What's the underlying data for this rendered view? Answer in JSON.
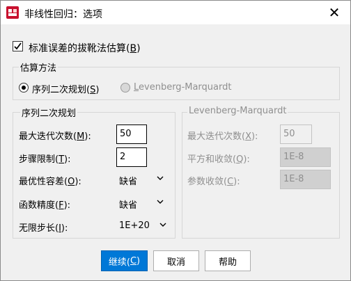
{
  "window": {
    "title": "非线性回归：选项",
    "close_glyph": "✕"
  },
  "bootstrap": {
    "checked": true,
    "label": "标准误差的拔靴法估算(",
    "mnemonic": "B",
    "suffix": ")"
  },
  "estimation": {
    "title": "估算方法",
    "options": [
      {
        "prefix": "序列二次规划(",
        "mnemonic": "S",
        "suffix": ")",
        "selected": true,
        "enabled": true
      },
      {
        "prefix": "",
        "mnemonic": "L",
        "suffix": "evenberg-Marquardt",
        "selected": false,
        "enabled": false
      }
    ]
  },
  "sqp": {
    "title": "序列二次规划",
    "fields": [
      {
        "prefix": "最大迭代次数(",
        "mnemonic": "M",
        "suffix": "):",
        "value": "50"
      },
      {
        "prefix": "步骤限制(",
        "mnemonic": "T",
        "suffix": "):",
        "value": "2"
      },
      {
        "prefix": "最优性容差(",
        "mnemonic": "O",
        "suffix": "):",
        "value": "缺省"
      },
      {
        "prefix": "函数精度(",
        "mnemonic": "F",
        "suffix": "):",
        "value": "缺省"
      },
      {
        "prefix": "无限步长(",
        "mnemonic": "I",
        "suffix": "):",
        "value": "1E+20"
      }
    ]
  },
  "lm": {
    "title": "Levenberg-Marquardt",
    "fields": [
      {
        "prefix": "最大迭代次数(",
        "mnemonic": "X",
        "suffix": "):",
        "value": "50"
      },
      {
        "prefix": "平方和收敛(",
        "mnemonic": "Q",
        "suffix": "):",
        "value": "1E-8"
      },
      {
        "prefix": "参数收敛(",
        "mnemonic": "C",
        "suffix": "):",
        "value": "1E-8"
      }
    ]
  },
  "buttons": {
    "continue": {
      "prefix": "继续(",
      "mnemonic": "C",
      "suffix": ")"
    },
    "cancel": "取消",
    "help": "帮助"
  },
  "colors": {
    "primary": "#0078d7",
    "disabled_text": "#8f8f8f"
  }
}
